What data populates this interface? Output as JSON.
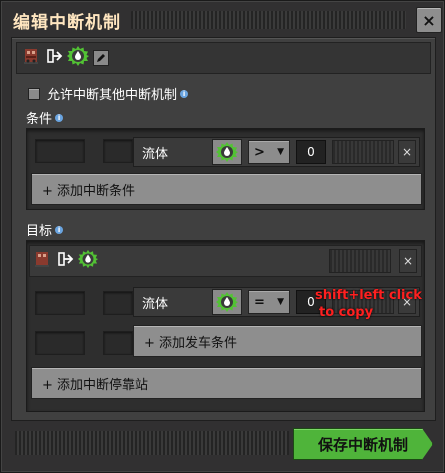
{
  "window": {
    "title": "编辑中断机制",
    "close_label": "×"
  },
  "allow_interrupt": {
    "label": "允许中断其他中断机制",
    "checked": false
  },
  "conditions_section": {
    "title": "条件",
    "condition": {
      "signal_label": "流体",
      "comparator": ">",
      "value": "0",
      "remove_label": "×"
    },
    "add_button": "+ 添加中断条件"
  },
  "targets_section": {
    "title": "目标",
    "remove_label": "×",
    "condition": {
      "signal_label": "流体",
      "comparator": "=",
      "value": "0",
      "remove_label": "×"
    },
    "add_departure_button": "+ 添加发车条件",
    "add_stop_button": "+ 添加中断停靠站"
  },
  "footer": {
    "save_button": "保存中断机制"
  },
  "tooltip": {
    "line1": "shift+left click",
    "line2": "to copy"
  },
  "icons": {
    "train": "train-stop-icon",
    "arrow": "enter-arrow-icon",
    "signal": "fluid-signal-icon",
    "edit": "edit-pencil-icon"
  },
  "colors": {
    "title": "#ffe6c0",
    "confirm": "#4fb43a",
    "signal_green": "#52c234",
    "tooltip": "#ff2020"
  }
}
